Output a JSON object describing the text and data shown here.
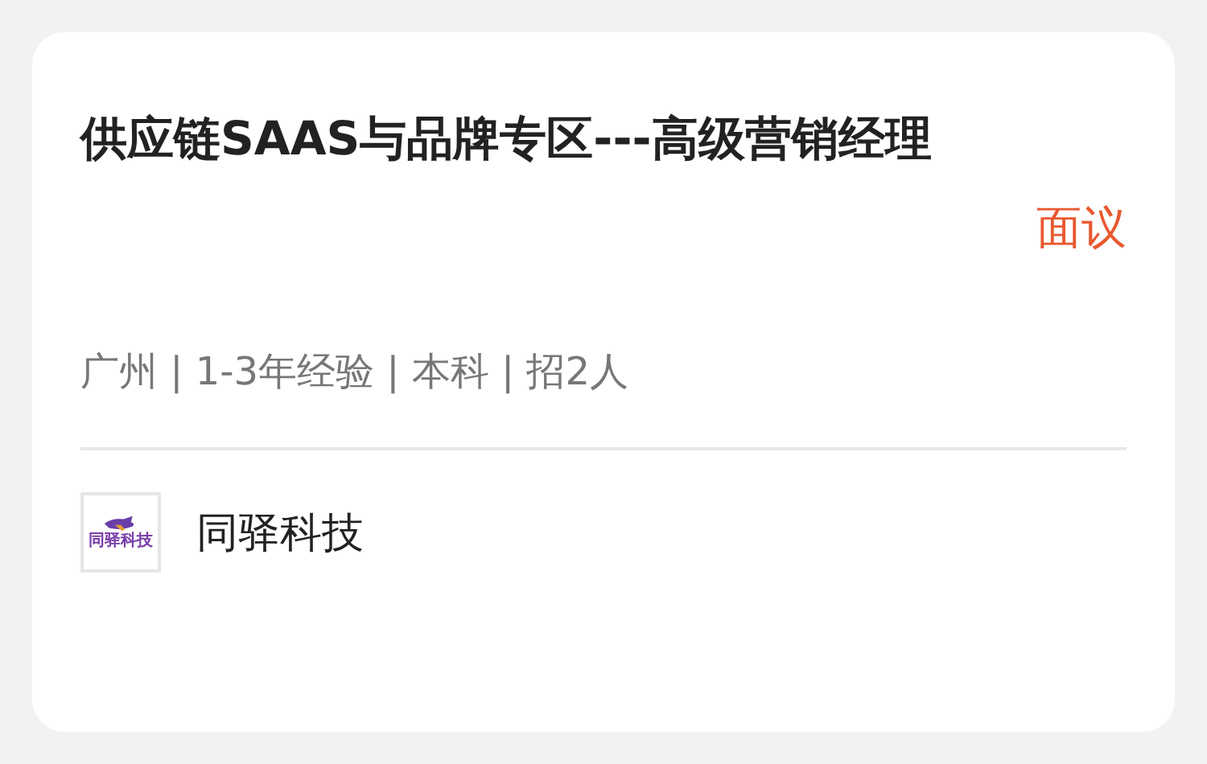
{
  "job": {
    "title": "供应链SAAS与品牌专区---高级营销经理",
    "salary": "面议",
    "details": "广州 | 1-3年经验 | 本科 | 招2人"
  },
  "company": {
    "logo_text": "同驿科技",
    "name": "同驿科技"
  }
}
